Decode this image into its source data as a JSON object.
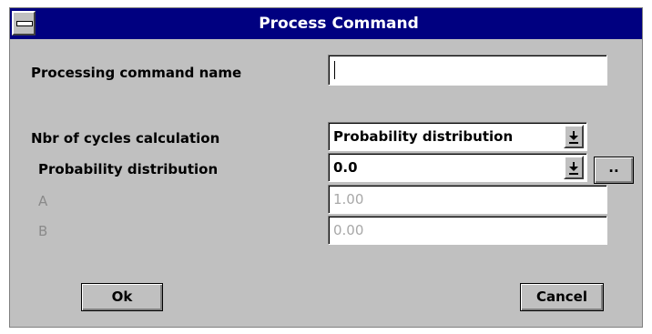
{
  "window": {
    "title": "Process Command"
  },
  "form": {
    "command_name_label": "Processing command name",
    "command_name_value": "",
    "cycles_label": "Nbr of cycles calculation",
    "cycles_value": "Probability distribution",
    "distribution_label": "Probability distribution",
    "distribution_value": "0.0",
    "browse_label": "..",
    "a_label": "A",
    "a_value": "1.00",
    "b_label": "B",
    "b_value": "0.00"
  },
  "buttons": {
    "ok_label": "Ok",
    "cancel_label": "Cancel"
  },
  "icons": {
    "system_menu": "system-menu-icon",
    "dropdown": "dropdown-arrow-icon"
  }
}
